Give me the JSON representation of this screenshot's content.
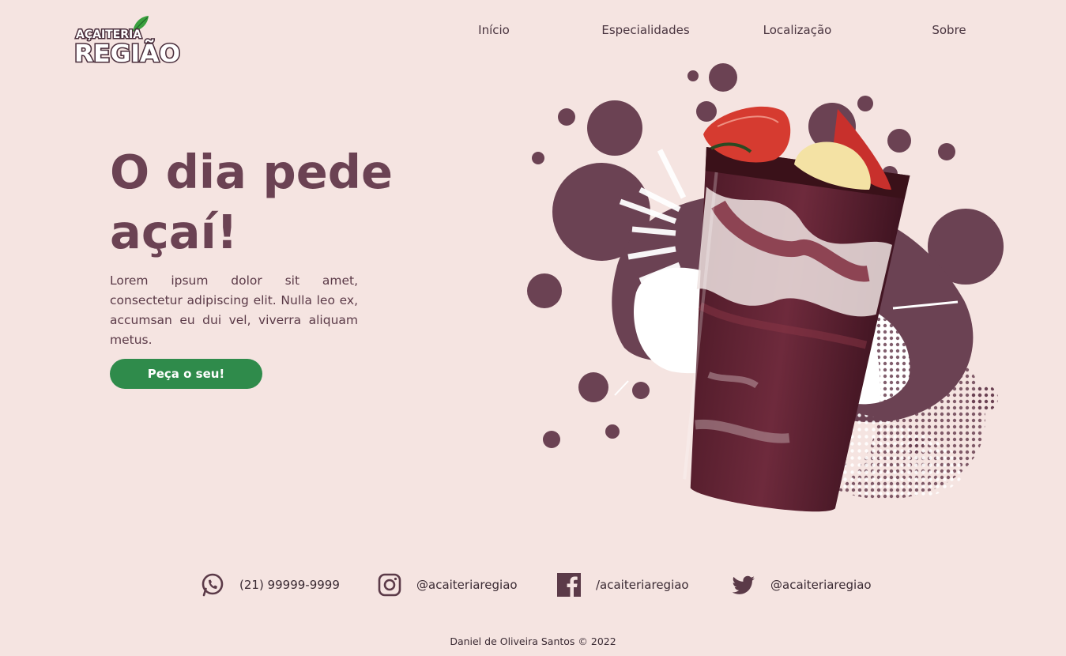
{
  "brand": {
    "logo_top": "AÇAITERIA",
    "logo_bottom": "REGIÃO",
    "colors": {
      "background": "#f5e4e1",
      "primary": "#6b4253",
      "accent": "#2f8b4b"
    }
  },
  "nav": {
    "items": [
      {
        "label": "Início"
      },
      {
        "label": "Especialidades"
      },
      {
        "label": "Localização"
      },
      {
        "label": "Sobre"
      }
    ]
  },
  "hero": {
    "title_line1": "O dia pede",
    "title_line2": "açaí!",
    "text": "Lorem ipsum dolor sit amet, consectetur adipiscing elit. Nulla leo ex, accumsan eu dui vel, viverra aliquam metus.",
    "cta_label": "Peça o seu!"
  },
  "contacts": [
    {
      "icon": "whatsapp-icon",
      "label": "(21) 99999-9999"
    },
    {
      "icon": "instagram-icon",
      "label": "@acaiteriaregiao"
    },
    {
      "icon": "facebook-icon",
      "label": "/acaiteriaregiao"
    },
    {
      "icon": "twitter-icon",
      "label": "@acaiteriaregiao"
    }
  ],
  "footer": {
    "text": "Daniel de Oliveira Santos © 2022"
  }
}
